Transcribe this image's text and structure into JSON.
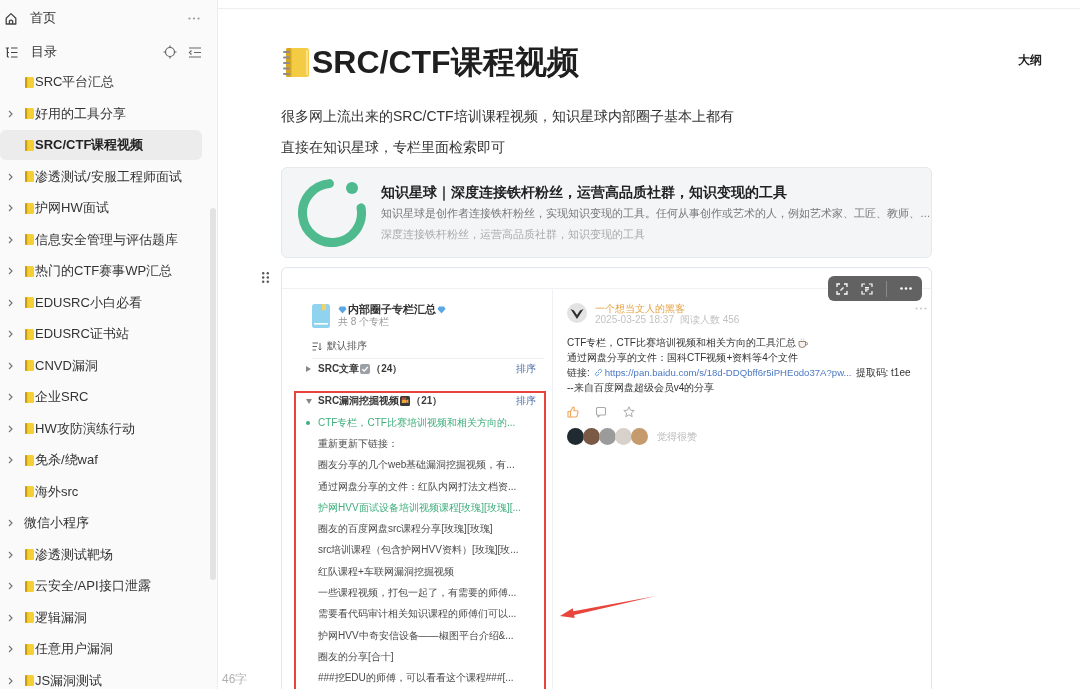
{
  "sidebar": {
    "home": {
      "label": "首页"
    },
    "toc": {
      "label": "目录"
    },
    "items": [
      {
        "label": "SRC平台汇总",
        "kind": "notebook",
        "expandable": false,
        "selected": false
      },
      {
        "label": "好用的工具分享",
        "kind": "notebook",
        "expandable": true,
        "selected": false
      },
      {
        "label": "SRC/CTF课程视频",
        "kind": "notebook",
        "expandable": false,
        "selected": true
      },
      {
        "label": "渗透测试/安服工程师面试",
        "kind": "notebook",
        "expandable": true,
        "selected": false
      },
      {
        "label": "护网HW面试",
        "kind": "notebook",
        "expandable": true,
        "selected": false
      },
      {
        "label": "信息安全管理与评估题库",
        "kind": "notebook",
        "expandable": true,
        "selected": false
      },
      {
        "label": "热门的CTF赛事WP汇总",
        "kind": "notebook",
        "expandable": true,
        "selected": false
      },
      {
        "label": "EDUSRC小白必看",
        "kind": "notebook",
        "expandable": true,
        "selected": false
      },
      {
        "label": "EDUSRC证书站",
        "kind": "notebook",
        "expandable": true,
        "selected": false
      },
      {
        "label": "CNVD漏洞",
        "kind": "notebook",
        "expandable": true,
        "selected": false
      },
      {
        "label": "企业SRC",
        "kind": "notebook",
        "expandable": true,
        "selected": false
      },
      {
        "label": "HW攻防演练行动",
        "kind": "notebook",
        "expandable": true,
        "selected": false
      },
      {
        "label": "免杀/绕waf",
        "kind": "notebook",
        "expandable": true,
        "selected": false
      },
      {
        "label": "海外src",
        "kind": "notebook",
        "expandable": false,
        "selected": false
      },
      {
        "label": "微信小程序",
        "kind": "plain",
        "expandable": true,
        "selected": false
      },
      {
        "label": "渗透测试靶场",
        "kind": "notebook",
        "expandable": true,
        "selected": false
      },
      {
        "label": "云安全/API接口泄露",
        "kind": "notebook",
        "expandable": true,
        "selected": false
      },
      {
        "label": "逻辑漏洞",
        "kind": "notebook",
        "expandable": true,
        "selected": false
      },
      {
        "label": "任意用户漏洞",
        "kind": "notebook",
        "expandable": true,
        "selected": false
      },
      {
        "label": "JS漏洞测试",
        "kind": "notebook",
        "expandable": true,
        "selected": false
      }
    ]
  },
  "outline": {
    "label": "大纲"
  },
  "page": {
    "title": "SRC/CTF课程视频",
    "paragraphs": [
      "很多网上流出来的SRC/CTF培训课程视频，知识星球内部圈子基本上都有",
      "直接在知识星球，专栏里面检索即可"
    ],
    "link_card": {
      "title": "知识星球｜深度连接铁杆粉丝，运营高品质社群，知识变现的工具",
      "description": "知识星球是创作者连接铁杆粉丝，实现知识变现的工具。任何从事创作或艺术的人，例如艺术家、工匠、教师、…",
      "subtitle": "深度连接铁杆粉丝，运营高品质社群，知识变现的工具"
    },
    "embedded_screenshot": {
      "column_list": {
        "title": "内部圈子专栏汇总",
        "subtitle": "共 8 个专栏",
        "sort_label": "默认排序",
        "sections": [
          {
            "kind": "article",
            "title": "SRC文章",
            "count": "（24）",
            "sort": "排序",
            "expanded": false,
            "highlighted": false
          },
          {
            "kind": "video",
            "title": "SRC漏洞挖掘视频",
            "count": "（21）",
            "sort": "排序",
            "expanded": true,
            "highlighted": true,
            "items": [
              {
                "text": "CTF专栏，CTF比赛培训视频和相关方向的...",
                "selected": true,
                "highlighted": true
              },
              {
                "text": "重新更新下链接：",
                "selected": false,
                "highlighted": false
              },
              {
                "text": "圈友分享的几个web基础漏洞挖掘视频，有...",
                "selected": false,
                "highlighted": false
              },
              {
                "text": "通过网盘分享的文件：红队内网打法文档资...",
                "selected": false,
                "highlighted": false
              },
              {
                "text": "护网HVV面试设备培训视频课程[玫瑰][玫瑰][...",
                "selected": false,
                "highlighted": true
              },
              {
                "text": "圈友的百度网盘src课程分享[玫瑰][玫瑰]",
                "selected": false,
                "highlighted": false
              },
              {
                "text": "src培训课程（包含护网HVV资料）[玫瑰][玫...",
                "selected": false,
                "highlighted": false
              },
              {
                "text": "红队课程+车联网漏洞挖掘视频",
                "selected": false,
                "highlighted": false
              },
              {
                "text": "一些课程视频，打包一起了，有需要的师傅...",
                "selected": false,
                "highlighted": false
              },
              {
                "text": "需要看代码审计相关知识课程的师傅们可以...",
                "selected": false,
                "highlighted": false
              },
              {
                "text": "护网HVV中奇安信设备——椒图平台介绍&...",
                "selected": false,
                "highlighted": false
              },
              {
                "text": "圈友的分享[合十]",
                "selected": false,
                "highlighted": false
              },
              {
                "text": "###挖EDU的师傅，可以看看这个课程###[...",
                "selected": false,
                "highlighted": false
              }
            ]
          }
        ]
      },
      "post": {
        "author": "一个想当文人的黑客",
        "date": "2025-03-25 18:37",
        "views": "阅读人数 456",
        "lines": [
          {
            "kind": "text",
            "text": "CTF专栏，CTF比赛培训视频和相关方向的工具汇总",
            "trailing_icon": true
          },
          {
            "kind": "text",
            "text": "通过网盘分享的文件：国科CTF视频+资料等4个文件",
            "trailing_icon": false
          },
          {
            "kind": "link",
            "label": "链接:",
            "url": "https://pan.baidu.com/s/18d-DDQbff6r5iPHEodo37A?pw...",
            "suffix": "提取码: t1ee"
          },
          {
            "kind": "text",
            "text": "--来自百度网盘超级会员v4的分享",
            "trailing_icon": false
          }
        ],
        "liked": true,
        "starred": false,
        "likers": [
          {
            "color": "#1f2b30"
          },
          {
            "color": "#7a5a45"
          },
          {
            "color": "#9b9b9b"
          },
          {
            "color": "#d6d1cb"
          },
          {
            "color": "#c59a6d"
          }
        ],
        "likers_label": "觉得很赞"
      }
    }
  },
  "word_count": "46字"
}
